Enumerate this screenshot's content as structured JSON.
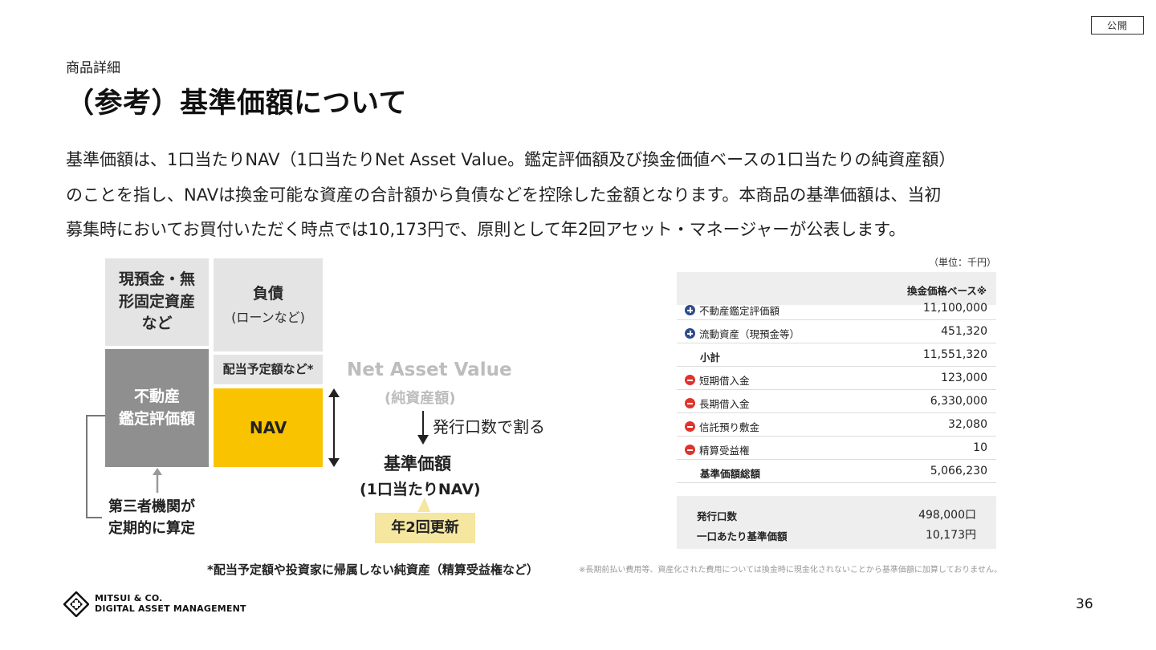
{
  "badge": "公開",
  "section_label": "商品詳細",
  "title": "（参考）基準価額について",
  "body_lines": [
    "基準価額は、1口当たりNAV（1口当たりNet Asset Value。鑑定評価額及び換金価値ベースの1口当たりの純資産額）",
    "のことを指し、NAVは換金可能な資産の合計額から負債などを控除した金額となります。本商品の基準価額は、当初",
    "募集時においてお買付いただく時点では10,173円で、原則として年2回アセット・マネージャーが公表します。"
  ],
  "diagram": {
    "cash_box": [
      "現預金・無",
      "形固定資産",
      "など"
    ],
    "liability_box": [
      "負債",
      "(ローンなど)"
    ],
    "dividend_box": "配当予定額など*",
    "real_estate_box": [
      "不動産",
      "鑑定評価額"
    ],
    "nav_box": "NAV",
    "nav_title": "Net Asset Value",
    "nav_sub": "(純資産額)",
    "divide_label": "発行口数で割る",
    "base_price_title": "基準価額",
    "base_price_sub": "(1口当たりNAV)",
    "update_badge": "年2回更新",
    "appraisal_note": [
      "第三者機関が",
      "定期的に算定"
    ]
  },
  "table": {
    "unit": "（単位：千円）",
    "header": "換金価格ベース※",
    "rows": [
      {
        "icon": "plus",
        "label": "不動産鑑定評価額",
        "value": "11,100,000"
      },
      {
        "icon": "plus",
        "label": "流動資産（現預金等）",
        "value": "451,320"
      },
      {
        "icon": "none",
        "label": "小計",
        "value": "11,551,320"
      },
      {
        "icon": "minus",
        "label": "短期借入金",
        "value": "123,000"
      },
      {
        "icon": "minus",
        "label": "長期借入金",
        "value": "6,330,000"
      },
      {
        "icon": "minus",
        "label": "信託預り敷金",
        "value": "32,080"
      },
      {
        "icon": "minus",
        "label": "精算受益権",
        "value": "10"
      },
      {
        "icon": "none",
        "label": "基準価額総額",
        "value": "5,066,230"
      }
    ],
    "summary": [
      {
        "label": "発行口数",
        "value": "498,000口"
      },
      {
        "label": "一口あたり基準価額",
        "value": "10,173円"
      }
    ]
  },
  "footnote_left": "*配当予定額や投資家に帰属しない純資産（精算受益権など）",
  "footnote_right": "※長期前払い費用等、資産化された費用については換金時に現金化されないことから基準価額に加算しておりません。",
  "logo": {
    "line1": "MITSUI & CO.",
    "line2": "DIGITAL ASSET MANAGEMENT"
  },
  "page_number": "36"
}
